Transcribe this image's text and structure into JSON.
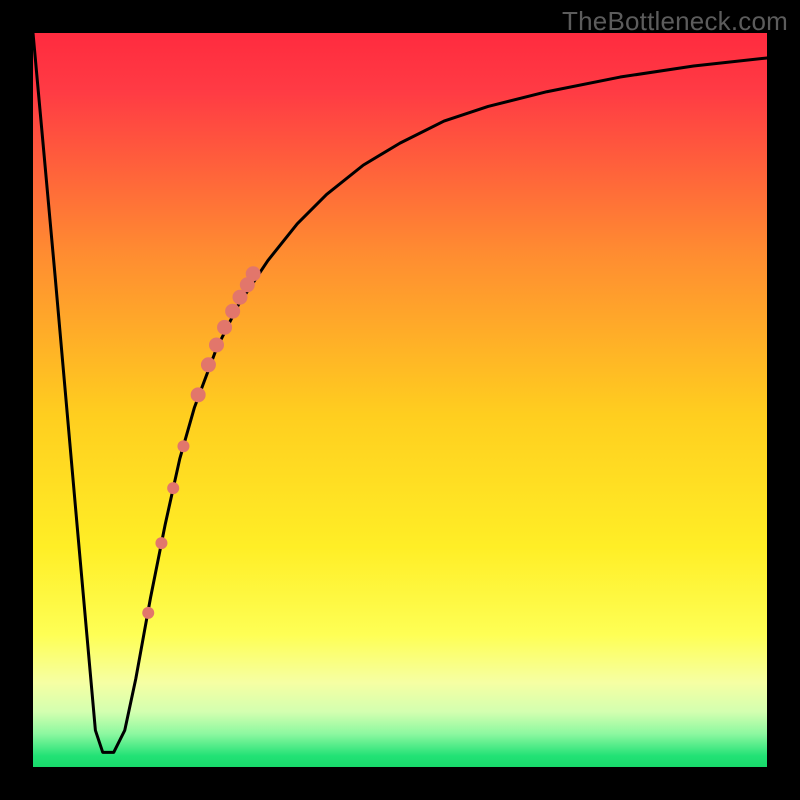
{
  "watermark": "TheBottleneck.com",
  "colors": {
    "frame": "#000000",
    "curve": "#000000",
    "marker": "#e2766b",
    "grad_top": "#ff2b3f",
    "grad_mid": "#ffd400",
    "grad_low": "#f8ff8f",
    "grad_green": "#18e06a"
  },
  "chart_data": {
    "type": "line",
    "title": "",
    "xlabel": "",
    "ylabel": "",
    "xlim": [
      0,
      100
    ],
    "ylim": [
      0,
      100
    ],
    "curve": {
      "x": [
        0,
        3,
        6,
        8.5,
        9.5,
        11,
        12.5,
        14,
        16,
        18,
        20,
        22,
        25,
        28,
        32,
        36,
        40,
        45,
        50,
        56,
        62,
        70,
        80,
        90,
        100
      ],
      "y": [
        100,
        67,
        33,
        5,
        2,
        2,
        5,
        12,
        23,
        33,
        42,
        49,
        57,
        63,
        69,
        74,
        78,
        82,
        85,
        88,
        90,
        92,
        94,
        95.5,
        96.6
      ]
    },
    "series": [
      {
        "name": "highlighted-points",
        "x": [
          15.7,
          17.5,
          19.1,
          20.5,
          22.5,
          23.9,
          25.0,
          26.1,
          27.2,
          28.2,
          29.2,
          30.0
        ],
        "y": [
          21.0,
          30.5,
          38.0,
          43.7,
          50.7,
          54.8,
          57.5,
          59.9,
          62.1,
          64.0,
          65.7,
          67.2
        ],
        "r": [
          6,
          6,
          6,
          6,
          7.5,
          7.5,
          7.5,
          7.5,
          7.5,
          7.5,
          7.5,
          7.5
        ]
      }
    ]
  }
}
